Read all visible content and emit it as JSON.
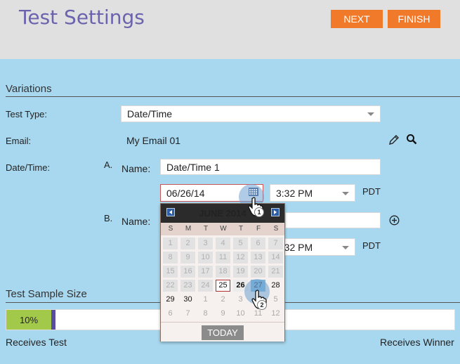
{
  "header": {
    "title": "Test Settings",
    "next_label": "NEXT",
    "finish_label": "FINISH"
  },
  "variations": {
    "section_title": "Variations",
    "test_type": {
      "label": "Test Type:",
      "value": "Date/Time"
    },
    "email": {
      "label": "Email:",
      "value": "My Email 01"
    },
    "datetime_label": "Date/Time:",
    "variant_a": {
      "letter": "A.",
      "name_label": "Name:",
      "name_value": "Date/Time 1",
      "date_value": "06/26/14",
      "time_value": "3:32 PM",
      "tz": "PDT"
    },
    "variant_b": {
      "letter": "B.",
      "name_label": "Name:",
      "time_value": "3:32 PM",
      "tz": "PDT"
    }
  },
  "calendar": {
    "month_label": "JUNE 2014",
    "days_of_week": [
      "S",
      "M",
      "T",
      "W",
      "T",
      "F",
      "S"
    ],
    "weeks": [
      [
        "1",
        "2",
        "3",
        "4",
        "5",
        "6",
        "7"
      ],
      [
        "8",
        "9",
        "10",
        "11",
        "12",
        "13",
        "14"
      ],
      [
        "15",
        "16",
        "17",
        "18",
        "19",
        "20",
        "21"
      ],
      [
        "22",
        "23",
        "24",
        "25",
        "26",
        "27",
        "28"
      ],
      [
        "29",
        "30",
        "1",
        "2",
        "3",
        "4",
        "5"
      ],
      [
        "6",
        "7",
        "8",
        "9",
        "10",
        "11",
        "12"
      ]
    ],
    "selected_day": "25",
    "current_day": "26",
    "hovered_day": "27",
    "today_label": "TODAY"
  },
  "sample_size": {
    "section_title": "Test Sample Size",
    "percent_label": "10%",
    "percent_value": 10,
    "left_label": "Receives Test",
    "right_label": "Receives Winner"
  },
  "annotations": {
    "step1": "1",
    "step2": "2"
  },
  "colors": {
    "accent_orange": "#f07a2a",
    "title_purple": "#6b63ad",
    "panel_blue": "#a8d8ef",
    "bar_green": "#a3c94a",
    "calendar_header": "#2b2b2b"
  },
  "icons": [
    "pencil-icon",
    "search-icon",
    "calendar-icon",
    "add-circle-icon",
    "chevron-left-icon",
    "chevron-right-icon",
    "hand-cursor-icon"
  ]
}
